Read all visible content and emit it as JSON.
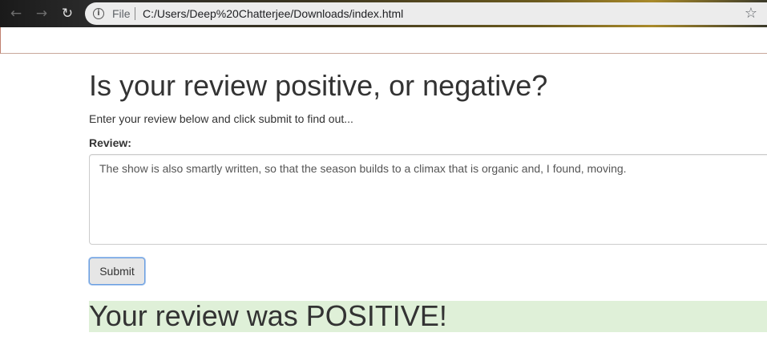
{
  "browser": {
    "back_icon": "←",
    "forward_icon": "→",
    "reload_icon": "↻",
    "info_icon": "i",
    "file_label": "File",
    "url": "C:/Users/Deep%20Chatterjee/Downloads/index.html",
    "star_icon": "☆"
  },
  "page": {
    "title": "Is your review positive, or negative?",
    "intro": "Enter your review below and click submit to find out...",
    "review_label": "Review:",
    "review_value": "The show is also smartly written, so that the season builds to a climax that is organic and, I found, moving.",
    "submit_label": "Submit",
    "result_text": "Your review was POSITIVE!"
  },
  "colors": {
    "result_background": "#dff0d8",
    "submit_focus_border": "#6a9ee0"
  }
}
